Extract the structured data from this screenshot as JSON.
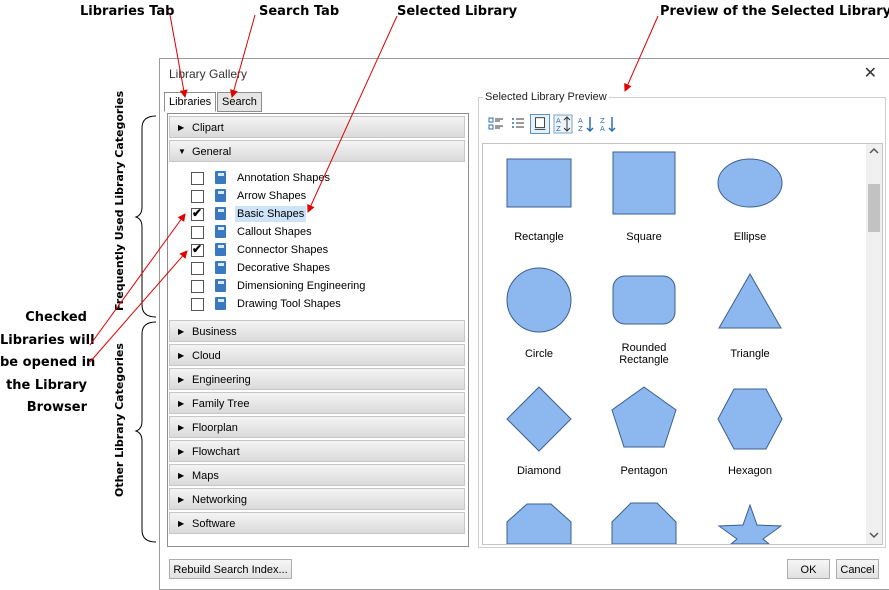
{
  "callouts": {
    "libraries_tab": "Libraries Tab",
    "search_tab": "Search Tab",
    "selected_library": "Selected Library",
    "preview_selected": "Preview of the Selected Library",
    "checked_line1": "Checked",
    "checked_line2": "Libraries will",
    "checked_line3": "be opened in",
    "checked_line4": "the Library",
    "checked_line5": "Browser",
    "frequently_used": "Frequently Used Library Categories",
    "other_categories": "Other Library Categories"
  },
  "dialog": {
    "title": "Library Gallery",
    "close": "✕",
    "tabs": {
      "libraries": "Libraries",
      "search": "Search"
    },
    "frequent_categories": [
      {
        "label": "Clipart",
        "arrow": "▶"
      },
      {
        "label": "General",
        "arrow": "▼"
      }
    ],
    "general_libraries": [
      {
        "label": "Annotation Shapes",
        "checked": ""
      },
      {
        "label": "Arrow Shapes",
        "checked": ""
      },
      {
        "label": "Basic Shapes",
        "checked": "✔"
      },
      {
        "label": "Callout Shapes",
        "checked": ""
      },
      {
        "label": "Connector Shapes",
        "checked": "✔"
      },
      {
        "label": "Decorative Shapes",
        "checked": ""
      },
      {
        "label": "Dimensioning Engineering",
        "checked": ""
      },
      {
        "label": "Drawing Tool Shapes",
        "checked": ""
      }
    ],
    "other_categories": [
      {
        "label": "Business",
        "arrow": "▶"
      },
      {
        "label": "Cloud",
        "arrow": "▶"
      },
      {
        "label": "Engineering",
        "arrow": "▶"
      },
      {
        "label": "Family Tree",
        "arrow": "▶"
      },
      {
        "label": "Floorplan",
        "arrow": "▶"
      },
      {
        "label": "Flowchart",
        "arrow": "▶"
      },
      {
        "label": "Maps",
        "arrow": "▶"
      },
      {
        "label": "Networking",
        "arrow": "▶"
      },
      {
        "label": "Software",
        "arrow": "▶"
      }
    ],
    "preview_title": "Selected Library Preview",
    "shapes": [
      {
        "label": "Rectangle"
      },
      {
        "label": "Square"
      },
      {
        "label": "Ellipse"
      },
      {
        "label": "Circle"
      },
      {
        "label": "Rounded Rectangle"
      },
      {
        "label": "Triangle"
      },
      {
        "label": "Diamond"
      },
      {
        "label": "Pentagon"
      },
      {
        "label": "Hexagon"
      }
    ],
    "buttons": {
      "rebuild": "Rebuild Search Index...",
      "ok": "OK",
      "cancel": "Cancel"
    },
    "colors": {
      "shape_fill": "#8db8ef",
      "shape_stroke": "#3b5f8f",
      "selection": "#cce3f8",
      "annotation_arrow": "#e00000"
    }
  }
}
